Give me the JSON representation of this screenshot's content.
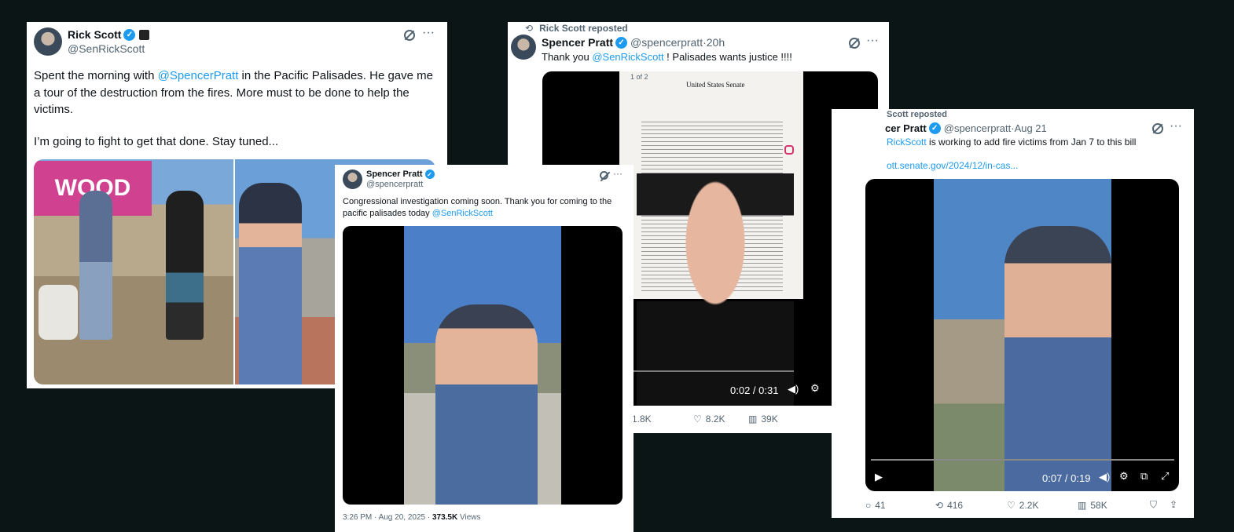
{
  "card1": {
    "name": "Rick Scott",
    "handle": "@SenRickScott",
    "text_a": "Spent the morning with ",
    "mention": "@SpencerPratt",
    "text_b": " in the Pacific Palisades. He gave me a tour of the destruction from the fires. More must to be done to help the victims.",
    "text_c": "I’m going to fight to get that done. Stay tuned...",
    "sign_text": "WOOD"
  },
  "card2": {
    "name": "Spencer Pratt",
    "handle": "@spencerpratt",
    "text_a": "Congressional investigation coming soon. Thank you for coming to the pacific palisades today ",
    "mention": "@SenRickScott",
    "time": "3:26 PM · Aug 20, 2025 · ",
    "views": "373.5K",
    "views_label": " Views"
  },
  "card3": {
    "repost": "Rick Scott reposted",
    "name": "Spencer Pratt",
    "handle": "@spencerpratt",
    "dot": " · ",
    "age": "20h",
    "text_a": "Thank you ",
    "mention": "@SenRickScott",
    "text_b": " ! Palisades wants justice !!!!",
    "page": "1 of 2",
    "letter_head": "United States Senate",
    "time": "0:02 / 0:31",
    "replies": "1.8K",
    "likes": "8.2K",
    "views": "39K"
  },
  "card4": {
    "repost": "Scott reposted",
    "name": "cer Pratt",
    "handle": "@spencerpratt",
    "dot": " · ",
    "age": "Aug 21",
    "mention": "RickScott",
    "text_b": " is working to add fire victims from Jan 7 to this bill",
    "link": "ott.senate.gov/2024/12/in-cas...",
    "time": "0:07 / 0:19",
    "replies": "41",
    "reposts": "416",
    "likes": "2.2K",
    "views": "58K"
  }
}
